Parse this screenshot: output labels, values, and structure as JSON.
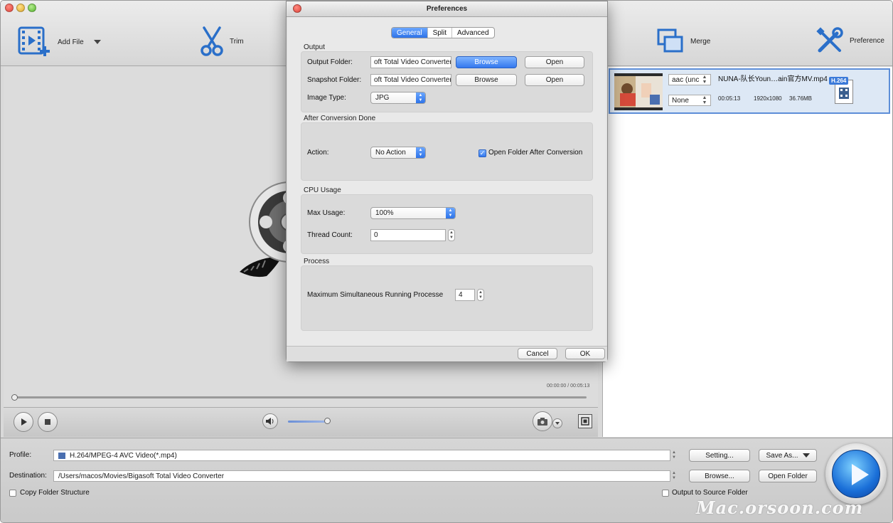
{
  "toolbar": {
    "add_file": "Add File",
    "trim": "Trim",
    "merge": "Merge",
    "preference": "Preference"
  },
  "player": {
    "time": "00:00:00 / 00:05:13",
    "volume_level": 0.95
  },
  "file_list": {
    "items": [
      {
        "name": "NUNA-队长Youn…ain官方MV.mp4",
        "audio_track": "aac (unc",
        "subtitle": "None",
        "duration": "00:05:13",
        "resolution": "1920x1080",
        "size": "36.76MB",
        "codec": "H.264"
      }
    ]
  },
  "bottom": {
    "profile_label": "Profile:",
    "profile_value": "H.264/MPEG-4 AVC Video(*.mp4)",
    "setting_button": "Setting...",
    "save_as_button": "Save As...",
    "destination_label": "Destination:",
    "destination_value": "/Users/macos/Movies/Bigasoft Total Video Converter",
    "browse_button": "Browse...",
    "open_folder_button": "Open Folder",
    "copy_folder_structure": "Copy Folder Structure",
    "output_to_source": "Output to Source Folder"
  },
  "watermark": "Mac.orsoon.com",
  "dialog": {
    "title": "Preferences",
    "tabs": [
      "General",
      "Split",
      "Advanced"
    ],
    "active_tab": "General",
    "output": {
      "title": "Output",
      "output_folder_label": "Output Folder:",
      "output_folder_value": "oft Total Video Converter",
      "snapshot_folder_label": "Snapshot Folder:",
      "snapshot_folder_value": "oft Total Video Converter",
      "browse": "Browse",
      "open": "Open",
      "image_type_label": "Image Type:",
      "image_type_value": "JPG"
    },
    "after_conversion": {
      "title": "After Conversion Done",
      "action_label": "Action:",
      "action_value": "No Action",
      "open_folder_label": "Open Folder After Conversion"
    },
    "cpu": {
      "title": "CPU Usage",
      "max_usage_label": "Max Usage:",
      "max_usage_value": "100%",
      "thread_count_label": "Thread Count:",
      "thread_count_value": "0"
    },
    "process": {
      "title": "Process",
      "max_label": "Maximum Simultaneous Running Processe",
      "max_value": "4"
    },
    "cancel": "Cancel",
    "ok": "OK"
  }
}
